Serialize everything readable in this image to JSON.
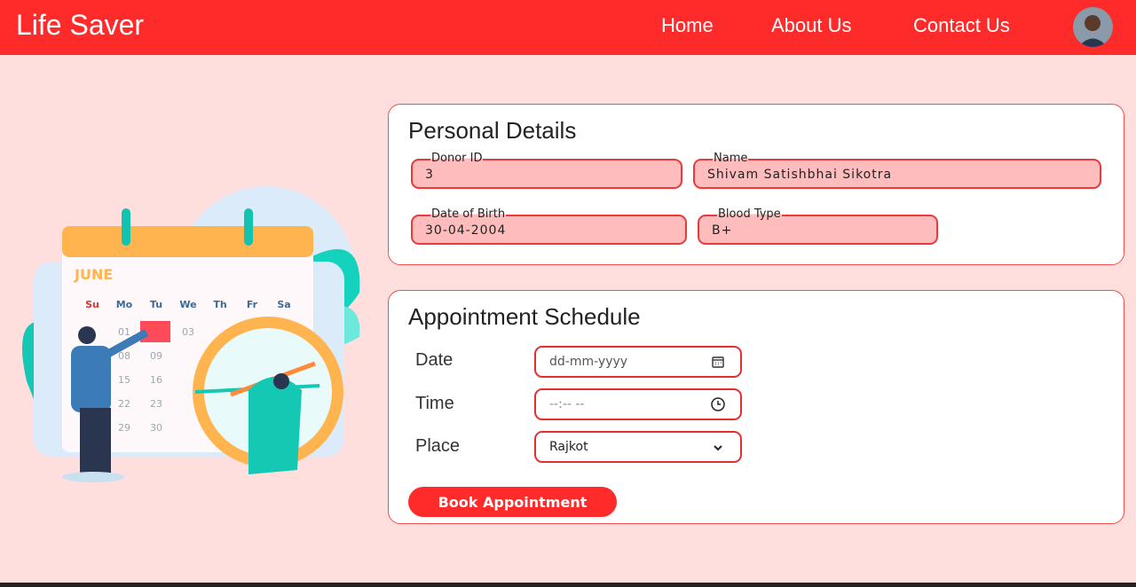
{
  "nav": {
    "brand": "Life Saver",
    "links": [
      "Home",
      "About Us",
      "Contact Us"
    ]
  },
  "illustration": {
    "month": "JUNE",
    "days": [
      "Su",
      "Mo",
      "Tu",
      "We",
      "Th",
      "Fr",
      "Sa"
    ],
    "dates": [
      "01",
      "02",
      "03",
      "08",
      "09",
      "15",
      "16",
      "22",
      "23",
      "29",
      "30"
    ]
  },
  "personal": {
    "title": "Personal Details",
    "fields": [
      {
        "label": "Donor ID",
        "value": "3"
      },
      {
        "label": "Name",
        "value": "Shivam Satishbhai Sikotra"
      },
      {
        "label": "Date of Birth",
        "value": "30-04-2004"
      },
      {
        "label": "Blood Type",
        "value": "B+"
      }
    ]
  },
  "appointment": {
    "title": "Appointment Schedule",
    "date_label": "Date",
    "date_placeholder": "dd-mm-yyyy",
    "time_label": "Time",
    "time_placeholder": "--:-- --",
    "place_label": "Place",
    "place_value": "Rajkot",
    "book_label": "Book Appointment"
  },
  "colors": {
    "primary": "#ff2a2a",
    "background": "#ffdede",
    "field": "#ffbcbc"
  }
}
